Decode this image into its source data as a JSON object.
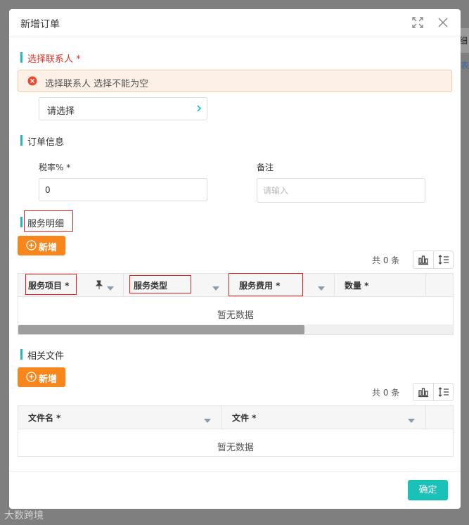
{
  "dialog": {
    "title": "新增订单"
  },
  "background": {
    "text_top": "细",
    "text_link": "表"
  },
  "watermark": "大数跨境",
  "contact": {
    "section_title": "选择联系人 *",
    "error": "选择联系人 选择不能为空",
    "select_placeholder": "请选择"
  },
  "order_info": {
    "section_title": "订单信息",
    "tax_label": "税率% *",
    "tax_value": "0",
    "remark_label": "备注",
    "remark_placeholder": "请输入"
  },
  "services": {
    "section_title": "服务明细",
    "add_label": "新增",
    "count_text": "共 0 条",
    "columns": [
      "服务项目 *",
      "服务类型",
      "服务费用 *",
      "数量 *"
    ],
    "empty_text": "暂无数据"
  },
  "files": {
    "section_title": "相关文件",
    "add_label": "新增",
    "count_text": "共 0 条",
    "columns": [
      "文件名 *",
      "文件 *"
    ],
    "empty_text": "暂无数据"
  },
  "footer": {
    "ok_label": "确定"
  },
  "colors": {
    "accent": "#19c1b6",
    "orange": "#f7861c",
    "error": "#e0322a"
  }
}
